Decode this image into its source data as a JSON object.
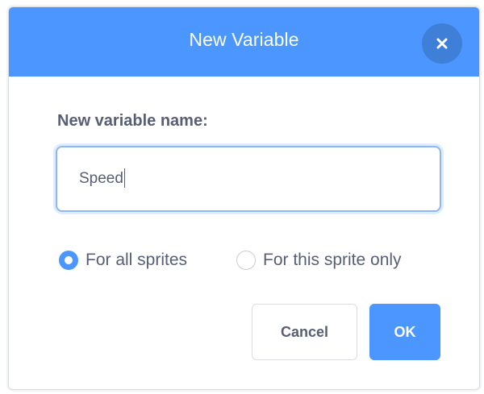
{
  "dialog": {
    "title": "New Variable",
    "close_icon": "close-icon"
  },
  "form": {
    "name_label": "New variable name:",
    "name_value": "Speed",
    "scope_options": [
      {
        "label": "For all sprites",
        "selected": true
      },
      {
        "label": "For this sprite only",
        "selected": false
      }
    ]
  },
  "actions": {
    "cancel_label": "Cancel",
    "ok_label": "OK"
  },
  "colors": {
    "header": "#4c97ff",
    "close_button": "#3f7fd8",
    "text": "#575e75",
    "primary": "#4c97ff"
  }
}
